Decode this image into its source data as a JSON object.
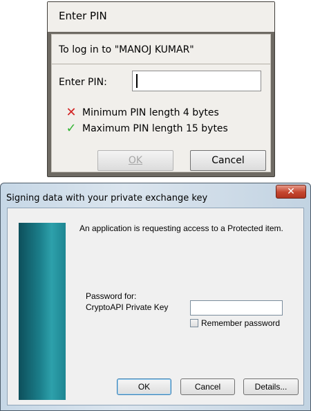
{
  "pin_dialog": {
    "title": "Enter PIN",
    "login_text": "To log in to \"MANOJ KUMAR\"",
    "pin_label": "Enter PIN:",
    "pin_value": "",
    "requirements": [
      {
        "text": "Minimum PIN length 4 bytes",
        "status": "fail",
        "icon": "red-x-icon"
      },
      {
        "text": "Maximum PIN length 15 bytes",
        "status": "pass",
        "icon": "green-check-icon"
      }
    ],
    "ok_label": "OK",
    "ok_enabled": false,
    "cancel_label": "Cancel"
  },
  "sign_dialog": {
    "title": "Signing data with your private exchange key",
    "close_icon": "close-icon",
    "info_text": "An application is requesting access to a Protected item.",
    "password_for_label": "Password for:",
    "key_name": "CryptoAPI Private Key",
    "password_value": "",
    "remember_label": "Remember password",
    "remember_checked": false,
    "ok_label": "OK",
    "cancel_label": "Cancel",
    "details_label": "Details..."
  },
  "colors": {
    "fail_icon": "#d22323",
    "pass_icon": "#35b535",
    "close_button": "#c4452e",
    "banner": "#1b7e8a"
  }
}
